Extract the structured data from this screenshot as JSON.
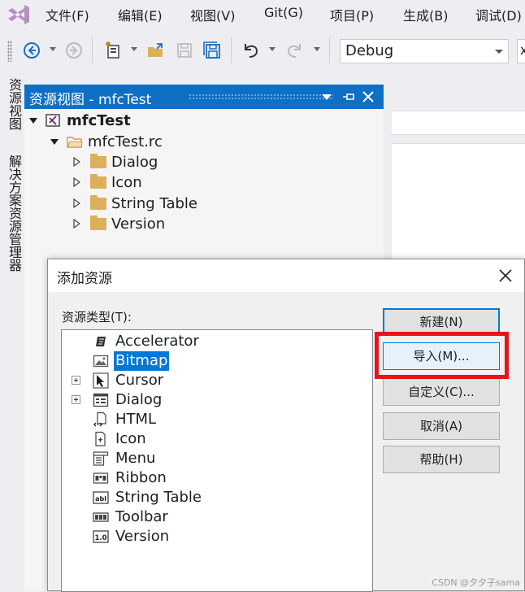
{
  "menubar": {
    "items": [
      "文件(F)",
      "编辑(E)",
      "视图(V)",
      "Git(G)",
      "项目(P)",
      "生成(B)",
      "调试(D)"
    ]
  },
  "toolbar": {
    "configuration": "Debug",
    "platform": "x"
  },
  "side_tabs": [
    "资源视图",
    "解决方案资源管理器"
  ],
  "resource_panel": {
    "title": "资源视图 - mfcTest",
    "project": "mfcTest",
    "rc_file": "mfcTest.rc",
    "folders": [
      "Dialog",
      "Icon",
      "String Table",
      "Version"
    ]
  },
  "dialog": {
    "title": "添加资源",
    "type_label": "资源类型(T):",
    "resource_types": [
      {
        "label": "Accelerator",
        "icon": "accelerator-icon",
        "expandable": false,
        "selected": false
      },
      {
        "label": "Bitmap",
        "icon": "bitmap-icon",
        "expandable": false,
        "selected": true
      },
      {
        "label": "Cursor",
        "icon": "cursor-icon",
        "expandable": true,
        "selected": false
      },
      {
        "label": "Dialog",
        "icon": "dialog-icon",
        "expandable": true,
        "selected": false
      },
      {
        "label": "HTML",
        "icon": "html-icon",
        "expandable": false,
        "selected": false
      },
      {
        "label": "Icon",
        "icon": "icon-resource-icon",
        "expandable": false,
        "selected": false
      },
      {
        "label": "Menu",
        "icon": "menu-icon",
        "expandable": false,
        "selected": false
      },
      {
        "label": "Ribbon",
        "icon": "ribbon-icon",
        "expandable": false,
        "selected": false
      },
      {
        "label": "String Table",
        "icon": "string-table-icon",
        "expandable": false,
        "selected": false
      },
      {
        "label": "Toolbar",
        "icon": "toolbar-icon",
        "expandable": false,
        "selected": false
      },
      {
        "label": "Version",
        "icon": "version-icon",
        "expandable": false,
        "selected": false
      }
    ],
    "buttons": {
      "new": "新建(N)",
      "import": "导入(M)...",
      "custom": "自定义(C)...",
      "cancel": "取消(A)",
      "help": "帮助(H)"
    }
  },
  "watermark": "CSDN @夕夕子sama",
  "colors": {
    "accent": "#0e6fc4",
    "selection": "#0078d7",
    "highlight_box": "#e8121b",
    "folder": "#dcb05a"
  }
}
